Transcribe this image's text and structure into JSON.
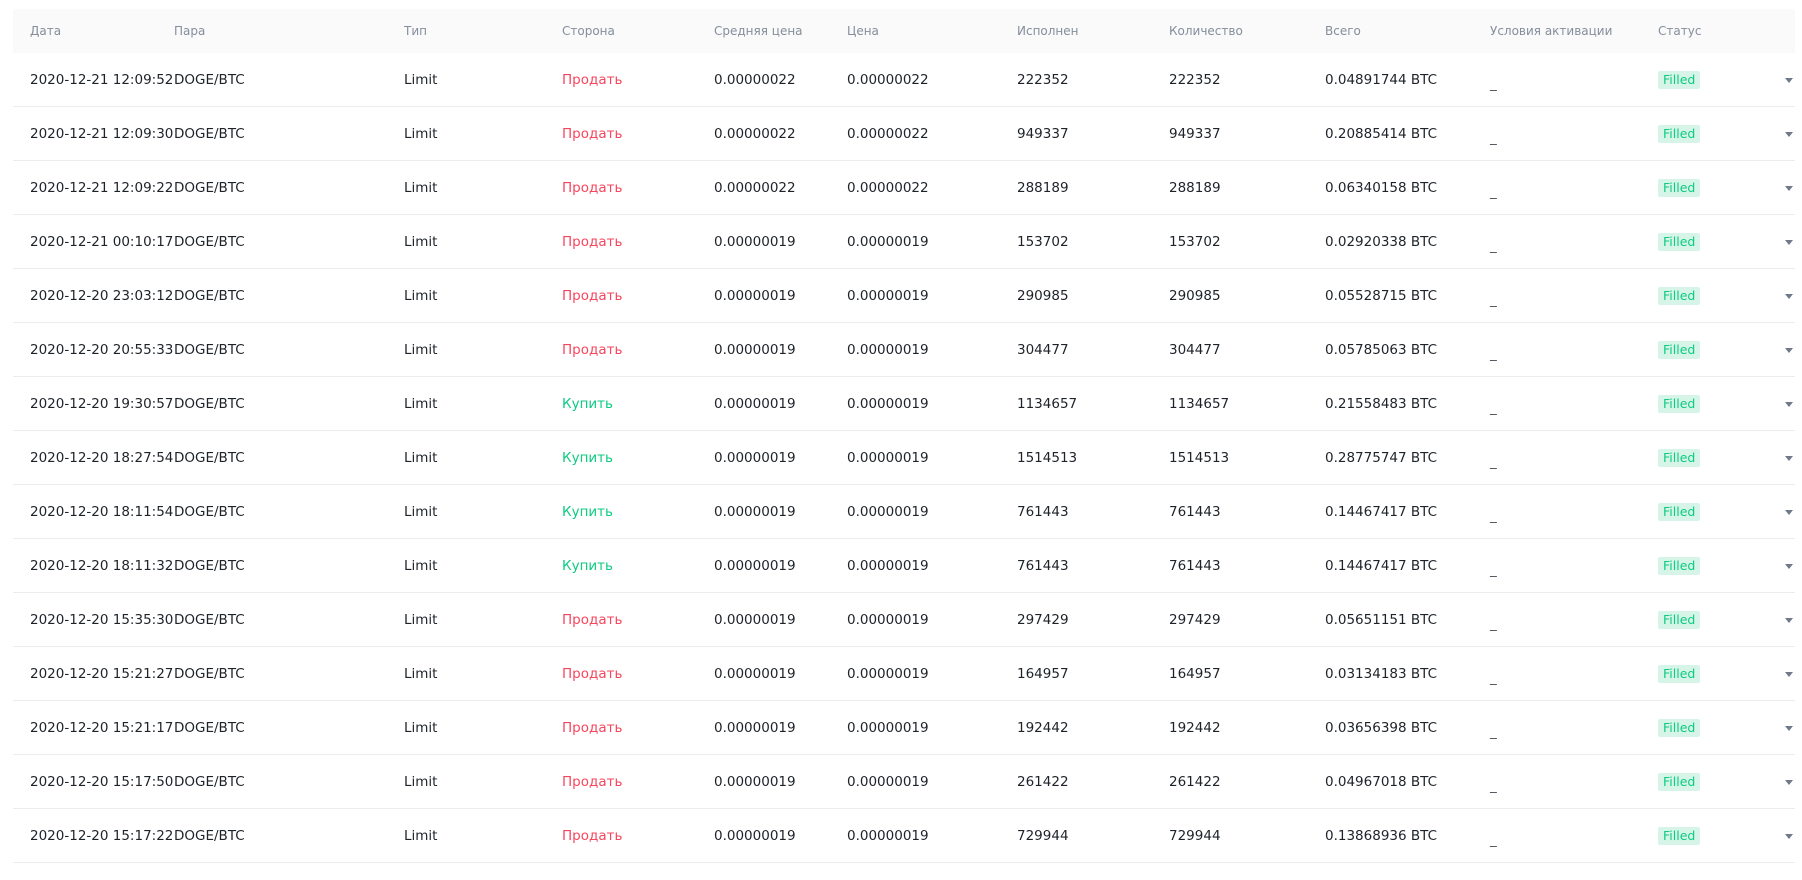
{
  "headers": {
    "date": "Дата",
    "pair": "Пара",
    "type": "Тип",
    "side": "Сторона",
    "avg_price": "Средняя цена",
    "price": "Цена",
    "filled": "Исполнен",
    "amount": "Количество",
    "total": "Всего",
    "trigger": "Условия активации",
    "status": "Статус"
  },
  "colors": {
    "sell": "#f6465d",
    "buy": "#0ecb81",
    "badge_bg": "#d6f5e8",
    "header_bg": "#fafafa"
  },
  "icons": {
    "expand": "chevron-down-icon"
  },
  "rows": [
    {
      "date": "2020-12-21 12:09:52",
      "pair": "DOGE/BTC",
      "type": "Limit",
      "side": "Продать",
      "side_kind": "sell",
      "avg_price": "0.00000022",
      "price": "0.00000022",
      "filled": "222352",
      "amount": "222352",
      "total": "0.04891744 BTC",
      "trigger": "_",
      "status": "Filled"
    },
    {
      "date": "2020-12-21 12:09:30",
      "pair": "DOGE/BTC",
      "type": "Limit",
      "side": "Продать",
      "side_kind": "sell",
      "avg_price": "0.00000022",
      "price": "0.00000022",
      "filled": "949337",
      "amount": "949337",
      "total": "0.20885414 BTC",
      "trigger": "_",
      "status": "Filled"
    },
    {
      "date": "2020-12-21 12:09:22",
      "pair": "DOGE/BTC",
      "type": "Limit",
      "side": "Продать",
      "side_kind": "sell",
      "avg_price": "0.00000022",
      "price": "0.00000022",
      "filled": "288189",
      "amount": "288189",
      "total": "0.06340158 BTC",
      "trigger": "_",
      "status": "Filled"
    },
    {
      "date": "2020-12-21 00:10:17",
      "pair": "DOGE/BTC",
      "type": "Limit",
      "side": "Продать",
      "side_kind": "sell",
      "avg_price": "0.00000019",
      "price": "0.00000019",
      "filled": "153702",
      "amount": "153702",
      "total": "0.02920338 BTC",
      "trigger": "_",
      "status": "Filled"
    },
    {
      "date": "2020-12-20 23:03:12",
      "pair": "DOGE/BTC",
      "type": "Limit",
      "side": "Продать",
      "side_kind": "sell",
      "avg_price": "0.00000019",
      "price": "0.00000019",
      "filled": "290985",
      "amount": "290985",
      "total": "0.05528715 BTC",
      "trigger": "_",
      "status": "Filled"
    },
    {
      "date": "2020-12-20 20:55:33",
      "pair": "DOGE/BTC",
      "type": "Limit",
      "side": "Продать",
      "side_kind": "sell",
      "avg_price": "0.00000019",
      "price": "0.00000019",
      "filled": "304477",
      "amount": "304477",
      "total": "0.05785063 BTC",
      "trigger": "_",
      "status": "Filled"
    },
    {
      "date": "2020-12-20 19:30:57",
      "pair": "DOGE/BTC",
      "type": "Limit",
      "side": "Купить",
      "side_kind": "buy",
      "avg_price": "0.00000019",
      "price": "0.00000019",
      "filled": "1134657",
      "amount": "1134657",
      "total": "0.21558483 BTC",
      "trigger": "_",
      "status": "Filled"
    },
    {
      "date": "2020-12-20 18:27:54",
      "pair": "DOGE/BTC",
      "type": "Limit",
      "side": "Купить",
      "side_kind": "buy",
      "avg_price": "0.00000019",
      "price": "0.00000019",
      "filled": "1514513",
      "amount": "1514513",
      "total": "0.28775747 BTC",
      "trigger": "_",
      "status": "Filled"
    },
    {
      "date": "2020-12-20 18:11:54",
      "pair": "DOGE/BTC",
      "type": "Limit",
      "side": "Купить",
      "side_kind": "buy",
      "avg_price": "0.00000019",
      "price": "0.00000019",
      "filled": "761443",
      "amount": "761443",
      "total": "0.14467417 BTC",
      "trigger": "_",
      "status": "Filled"
    },
    {
      "date": "2020-12-20 18:11:32",
      "pair": "DOGE/BTC",
      "type": "Limit",
      "side": "Купить",
      "side_kind": "buy",
      "avg_price": "0.00000019",
      "price": "0.00000019",
      "filled": "761443",
      "amount": "761443",
      "total": "0.14467417 BTC",
      "trigger": "_",
      "status": "Filled"
    },
    {
      "date": "2020-12-20 15:35:30",
      "pair": "DOGE/BTC",
      "type": "Limit",
      "side": "Продать",
      "side_kind": "sell",
      "avg_price": "0.00000019",
      "price": "0.00000019",
      "filled": "297429",
      "amount": "297429",
      "total": "0.05651151 BTC",
      "trigger": "_",
      "status": "Filled"
    },
    {
      "date": "2020-12-20 15:21:27",
      "pair": "DOGE/BTC",
      "type": "Limit",
      "side": "Продать",
      "side_kind": "sell",
      "avg_price": "0.00000019",
      "price": "0.00000019",
      "filled": "164957",
      "amount": "164957",
      "total": "0.03134183 BTC",
      "trigger": "_",
      "status": "Filled"
    },
    {
      "date": "2020-12-20 15:21:17",
      "pair": "DOGE/BTC",
      "type": "Limit",
      "side": "Продать",
      "side_kind": "sell",
      "avg_price": "0.00000019",
      "price": "0.00000019",
      "filled": "192442",
      "amount": "192442",
      "total": "0.03656398 BTC",
      "trigger": "_",
      "status": "Filled"
    },
    {
      "date": "2020-12-20 15:17:50",
      "pair": "DOGE/BTC",
      "type": "Limit",
      "side": "Продать",
      "side_kind": "sell",
      "avg_price": "0.00000019",
      "price": "0.00000019",
      "filled": "261422",
      "amount": "261422",
      "total": "0.04967018 BTC",
      "trigger": "_",
      "status": "Filled"
    },
    {
      "date": "2020-12-20 15:17:22",
      "pair": "DOGE/BTC",
      "type": "Limit",
      "side": "Продать",
      "side_kind": "sell",
      "avg_price": "0.00000019",
      "price": "0.00000019",
      "filled": "729944",
      "amount": "729944",
      "total": "0.13868936 BTC",
      "trigger": "_",
      "status": "Filled"
    }
  ]
}
